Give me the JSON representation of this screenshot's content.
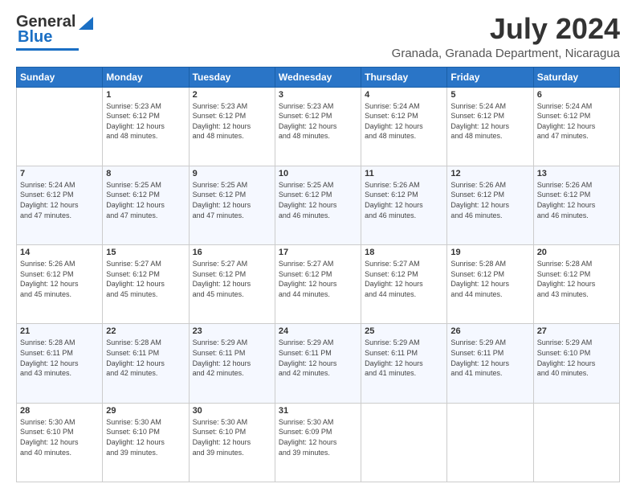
{
  "header": {
    "logo_line1": "General",
    "logo_line2": "Blue",
    "month_year": "July 2024",
    "location": "Granada, Granada Department, Nicaragua"
  },
  "weekdays": [
    "Sunday",
    "Monday",
    "Tuesday",
    "Wednesday",
    "Thursday",
    "Friday",
    "Saturday"
  ],
  "weeks": [
    [
      {
        "day": "",
        "sunrise": "",
        "sunset": "",
        "daylight": ""
      },
      {
        "day": "1",
        "sunrise": "5:23 AM",
        "sunset": "6:12 PM",
        "daylight": "12 hours and 48 minutes."
      },
      {
        "day": "2",
        "sunrise": "5:23 AM",
        "sunset": "6:12 PM",
        "daylight": "12 hours and 48 minutes."
      },
      {
        "day": "3",
        "sunrise": "5:23 AM",
        "sunset": "6:12 PM",
        "daylight": "12 hours and 48 minutes."
      },
      {
        "day": "4",
        "sunrise": "5:24 AM",
        "sunset": "6:12 PM",
        "daylight": "12 hours and 48 minutes."
      },
      {
        "day": "5",
        "sunrise": "5:24 AM",
        "sunset": "6:12 PM",
        "daylight": "12 hours and 48 minutes."
      },
      {
        "day": "6",
        "sunrise": "5:24 AM",
        "sunset": "6:12 PM",
        "daylight": "12 hours and 47 minutes."
      }
    ],
    [
      {
        "day": "7",
        "sunrise": "5:24 AM",
        "sunset": "6:12 PM",
        "daylight": "12 hours and 47 minutes."
      },
      {
        "day": "8",
        "sunrise": "5:25 AM",
        "sunset": "6:12 PM",
        "daylight": "12 hours and 47 minutes."
      },
      {
        "day": "9",
        "sunrise": "5:25 AM",
        "sunset": "6:12 PM",
        "daylight": "12 hours and 47 minutes."
      },
      {
        "day": "10",
        "sunrise": "5:25 AM",
        "sunset": "6:12 PM",
        "daylight": "12 hours and 46 minutes."
      },
      {
        "day": "11",
        "sunrise": "5:26 AM",
        "sunset": "6:12 PM",
        "daylight": "12 hours and 46 minutes."
      },
      {
        "day": "12",
        "sunrise": "5:26 AM",
        "sunset": "6:12 PM",
        "daylight": "12 hours and 46 minutes."
      },
      {
        "day": "13",
        "sunrise": "5:26 AM",
        "sunset": "6:12 PM",
        "daylight": "12 hours and 46 minutes."
      }
    ],
    [
      {
        "day": "14",
        "sunrise": "5:26 AM",
        "sunset": "6:12 PM",
        "daylight": "12 hours and 45 minutes."
      },
      {
        "day": "15",
        "sunrise": "5:27 AM",
        "sunset": "6:12 PM",
        "daylight": "12 hours and 45 minutes."
      },
      {
        "day": "16",
        "sunrise": "5:27 AM",
        "sunset": "6:12 PM",
        "daylight": "12 hours and 45 minutes."
      },
      {
        "day": "17",
        "sunrise": "5:27 AM",
        "sunset": "6:12 PM",
        "daylight": "12 hours and 44 minutes."
      },
      {
        "day": "18",
        "sunrise": "5:27 AM",
        "sunset": "6:12 PM",
        "daylight": "12 hours and 44 minutes."
      },
      {
        "day": "19",
        "sunrise": "5:28 AM",
        "sunset": "6:12 PM",
        "daylight": "12 hours and 44 minutes."
      },
      {
        "day": "20",
        "sunrise": "5:28 AM",
        "sunset": "6:12 PM",
        "daylight": "12 hours and 43 minutes."
      }
    ],
    [
      {
        "day": "21",
        "sunrise": "5:28 AM",
        "sunset": "6:11 PM",
        "daylight": "12 hours and 43 minutes."
      },
      {
        "day": "22",
        "sunrise": "5:28 AM",
        "sunset": "6:11 PM",
        "daylight": "12 hours and 42 minutes."
      },
      {
        "day": "23",
        "sunrise": "5:29 AM",
        "sunset": "6:11 PM",
        "daylight": "12 hours and 42 minutes."
      },
      {
        "day": "24",
        "sunrise": "5:29 AM",
        "sunset": "6:11 PM",
        "daylight": "12 hours and 42 minutes."
      },
      {
        "day": "25",
        "sunrise": "5:29 AM",
        "sunset": "6:11 PM",
        "daylight": "12 hours and 41 minutes."
      },
      {
        "day": "26",
        "sunrise": "5:29 AM",
        "sunset": "6:11 PM",
        "daylight": "12 hours and 41 minutes."
      },
      {
        "day": "27",
        "sunrise": "5:29 AM",
        "sunset": "6:10 PM",
        "daylight": "12 hours and 40 minutes."
      }
    ],
    [
      {
        "day": "28",
        "sunrise": "5:30 AM",
        "sunset": "6:10 PM",
        "daylight": "12 hours and 40 minutes."
      },
      {
        "day": "29",
        "sunrise": "5:30 AM",
        "sunset": "6:10 PM",
        "daylight": "12 hours and 39 minutes."
      },
      {
        "day": "30",
        "sunrise": "5:30 AM",
        "sunset": "6:10 PM",
        "daylight": "12 hours and 39 minutes."
      },
      {
        "day": "31",
        "sunrise": "5:30 AM",
        "sunset": "6:09 PM",
        "daylight": "12 hours and 39 minutes."
      },
      {
        "day": "",
        "sunrise": "",
        "sunset": "",
        "daylight": ""
      },
      {
        "day": "",
        "sunrise": "",
        "sunset": "",
        "daylight": ""
      },
      {
        "day": "",
        "sunrise": "",
        "sunset": "",
        "daylight": ""
      }
    ]
  ]
}
